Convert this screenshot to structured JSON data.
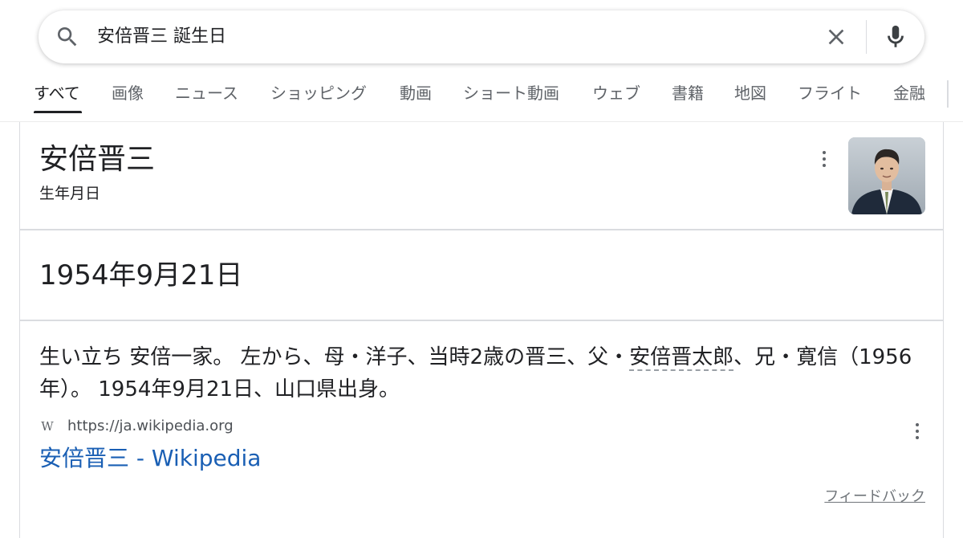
{
  "search": {
    "query": "安倍晋三 誕生日",
    "search_icon": "search-icon",
    "clear_icon": "close-icon",
    "mic_icon": "microphone-icon"
  },
  "tabs": [
    {
      "label": "すべて",
      "active": true
    },
    {
      "label": "画像",
      "active": false
    },
    {
      "label": "ニュース",
      "active": false
    },
    {
      "label": "ショッピング",
      "active": false
    },
    {
      "label": "動画",
      "active": false
    },
    {
      "label": "ショート動画",
      "active": false
    },
    {
      "label": "ウェブ",
      "active": false
    },
    {
      "label": "書籍",
      "active": false
    },
    {
      "label": "地図",
      "active": false
    },
    {
      "label": "フライト",
      "active": false
    },
    {
      "label": "金融",
      "active": false
    }
  ],
  "entity": {
    "title": "安倍晋三",
    "subtitle": "生年月日",
    "more_icon": "more-vert-icon",
    "image": "portrait-photo"
  },
  "answer": {
    "value": "1954年9月21日"
  },
  "snippet": {
    "text_before": "生い立ち 安倍一家。 左から、母・洋子、当時2歳の晋三、父・",
    "linked_text": "安倍晋太郎",
    "text_after": "、兄・寛信（1956年）。 1954年9月21日、山口県出身。"
  },
  "source": {
    "favicon": "W",
    "url": "https://ja.wikipedia.org",
    "title": "安倍晋三 - Wikipedia",
    "more_icon": "more-vert-icon"
  },
  "feedback": {
    "label": "フィードバック"
  },
  "colors": {
    "link": "#1a5fb4",
    "text": "#202124",
    "secondary_text": "#5f6368",
    "divider": "#dadce0"
  }
}
